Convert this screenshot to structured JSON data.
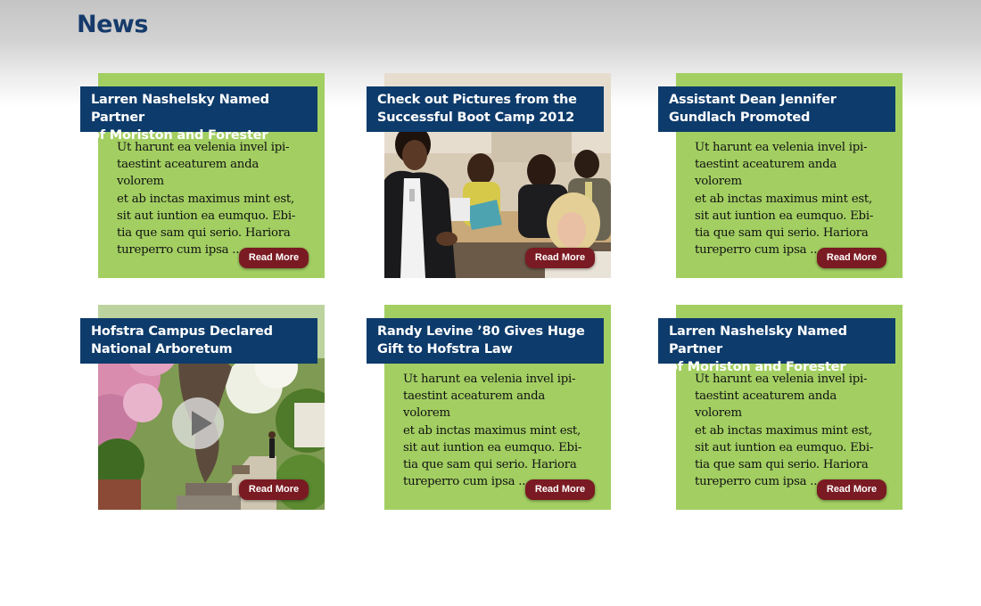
{
  "page": {
    "title": "News"
  },
  "cards": [
    {
      "title": "Larren Nashelsky Named Partner\nof Moriston and Forester",
      "body": "Ut harunt ea velenia invel ipi-\ntaestint aceaturem anda volorem\net ab inctas maximus mint est,\nsit aut iuntion ea eumquo. Ebi-\ntia que sam qui serio. Hariora\ntureperro cum ipsa ...",
      "button": "Read More"
    },
    {
      "title": "Check out Pictures from  the\nSuccessful Boot Camp 2012",
      "button": "Read More",
      "image": "group-meeting-photo"
    },
    {
      "title": "Assistant Dean Jennifer\nGundlach Promoted",
      "body": "Ut harunt ea velenia invel ipi-\ntaestint aceaturem anda volorem\net ab inctas maximus mint est,\nsit aut iuntion ea eumquo. Ebi-\ntia que sam qui serio. Hariora\ntureperro cum ipsa ...",
      "button": "Read More"
    },
    {
      "title": "Hofstra Campus Declared\nNational Arboretum",
      "button": "Read More",
      "image": "campus-garden-photo",
      "video_icon": "play-icon"
    },
    {
      "title": "Randy Levine ’80 Gives Huge\nGift to Hofstra Law",
      "body": "Ut harunt ea velenia invel ipi-\ntaestint aceaturem anda volorem\net ab inctas maximus mint est,\nsit aut iuntion ea eumquo. Ebi-\ntia que sam qui serio. Hariora\ntureperro cum ipsa ...",
      "button": "Read More"
    },
    {
      "title": "Larren Nashelsky Named Partner\nof Moriston and Forester",
      "body": "Ut harunt ea velenia invel ipi-\ntaestint aceaturem anda volorem\net ab inctas maximus mint est,\nsit aut iuntion ea eumquo. Ebi-\ntia que sam qui serio. Hariora\ntureperro cum ipsa ...",
      "button": "Read More"
    }
  ],
  "colors": {
    "card_green": "#a3cf62",
    "title_navy": "#0d3b6b",
    "button_maroon": "#7a1a22",
    "heading_blue": "#163a6b"
  }
}
